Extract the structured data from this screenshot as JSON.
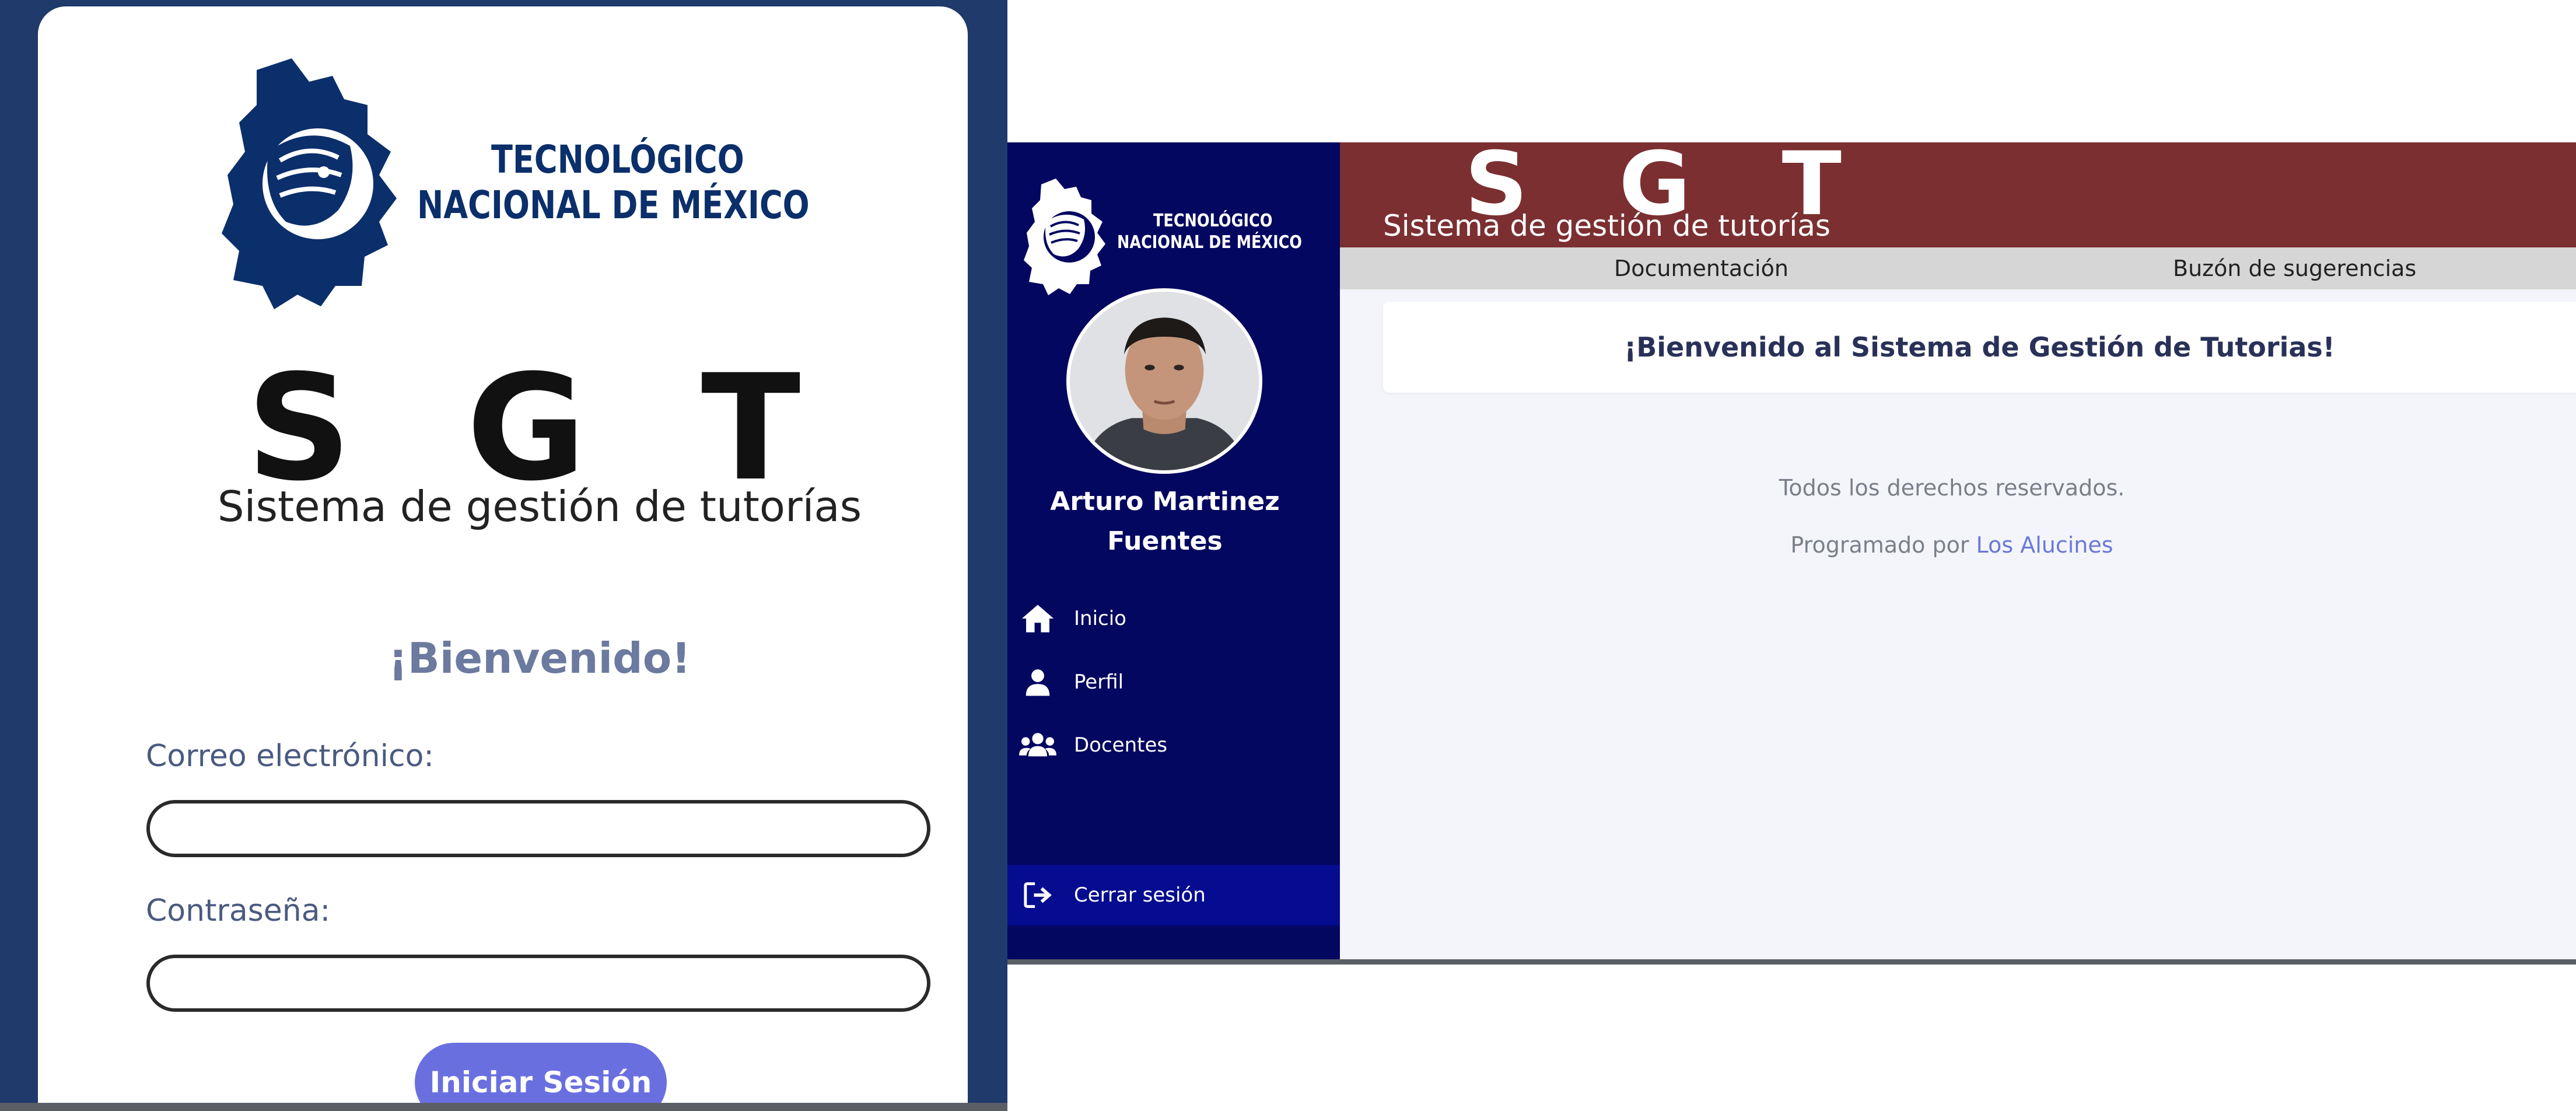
{
  "login": {
    "logo_line1": "TECNOLÓGICO",
    "logo_line2": "NACIONAL DE MÉXICO",
    "app_short": "S G T",
    "app_full": "Sistema de gestión de tutorías",
    "welcome": "¡Bienvenido!",
    "email_label": "Correo electrónico:",
    "email_value": "",
    "password_label": "Contraseña:",
    "password_value": "",
    "submit_label": "Iniciar Sesión"
  },
  "dashboard": {
    "sidebar": {
      "logo_line1": "TECNOLÓGICO",
      "logo_line2": "NACIONAL DE MÉXICO",
      "user_name": "Arturo Martinez Fuentes",
      "items": [
        {
          "label": "Inicio",
          "icon": "home-icon"
        },
        {
          "label": "Perfil",
          "icon": "user-icon"
        },
        {
          "label": "Docentes",
          "icon": "users-icon"
        }
      ],
      "logout_label": "Cerrar sesión"
    },
    "header": {
      "app_short": "S G T",
      "app_full": "Sistema de gestión de tutorías"
    },
    "menu": {
      "documentation": "Documentación",
      "suggestions": "Buzón de sugerencias"
    },
    "welcome_message": "¡Bienvenido al Sistema de Gestión de Tutorias!",
    "footer": {
      "rights": "Todos los derechos reservados.",
      "programmed_by": "Programado por",
      "team": "Los Alucines"
    }
  },
  "colors": {
    "login_bg": "#1f3a6b",
    "tecnm_blue": "#0b2f6b",
    "button": "#6a6fe0",
    "sidebar": "#040760",
    "header": "#7b2f31",
    "menubar": "#d6d6d6"
  }
}
